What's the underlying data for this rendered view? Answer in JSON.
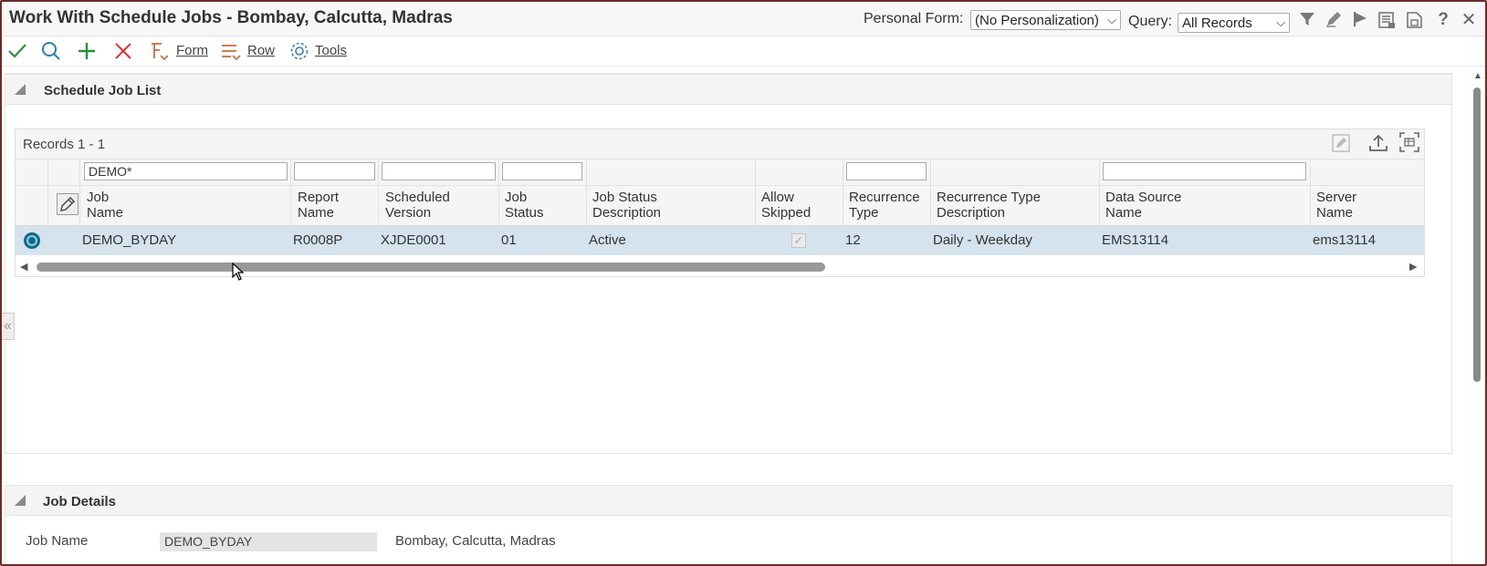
{
  "app": {
    "title": "Work With Schedule Jobs - Bombay, Calcutta, Madras"
  },
  "header": {
    "personal_form_label": "Personal Form:",
    "personal_form_value": "(No Personalization)",
    "query_label": "Query:",
    "query_value": "All Records",
    "icons": [
      "filter-icon",
      "pencil-icon",
      "flag-icon",
      "list-report-icon",
      "save-form-icon",
      "help-icon",
      "close-icon"
    ]
  },
  "toolbar": {
    "select_icon": "checkmark-icon",
    "find_icon": "search-icon",
    "add_icon": "plus-icon",
    "delete_icon": "x-icon",
    "form_label": "Form",
    "row_label": "Row",
    "tools_label": "Tools"
  },
  "schedule_list": {
    "title": "Schedule Job List",
    "records": "Records 1 - 1",
    "filters": {
      "job_name": "DEMO*",
      "report_name": "",
      "scheduled_version": "",
      "job_status": "",
      "recurrence_type": "",
      "data_source_name": ""
    },
    "columns": {
      "job_name": [
        "Job",
        "Name"
      ],
      "report_name": [
        "Report",
        "Name"
      ],
      "scheduled_version": [
        "Scheduled",
        "Version"
      ],
      "job_status": [
        "Job",
        "Status"
      ],
      "job_status_desc": [
        "Job Status",
        "Description"
      ],
      "allow_skipped": [
        "Allow",
        "Skipped"
      ],
      "recurrence_type": [
        "Recurrence",
        "Type"
      ],
      "recurrence_type_desc": [
        "Recurrence Type",
        "Description"
      ],
      "data_source_name": [
        "Data Source",
        "Name"
      ],
      "server_name": [
        "Server",
        "Name"
      ]
    },
    "rows": [
      {
        "job_name": "DEMO_BYDAY",
        "report_name": "R0008P",
        "scheduled_version": "XJDE0001",
        "job_status": "01",
        "job_status_desc": "Active",
        "allow_skipped": "checked",
        "recurrence_type": "12",
        "recurrence_type_desc": "Daily - Weekday",
        "data_source_name": "EMS13114",
        "server_name": "ems13114"
      }
    ]
  },
  "job_details": {
    "title": "Job Details",
    "job_name_label": "Job Name",
    "job_name_value": "DEMO_BYDAY",
    "job_name_desc": "Bombay, Calcutta, Madras"
  },
  "colors": {
    "selected_row": "#d5e3ee",
    "radio": "#0d6a8a",
    "check_green": "#3a8a3a",
    "add_green": "#2e8b3a",
    "delete_red": "#d33",
    "search_blue": "#2a7fb8",
    "frame": "#6b2a2a"
  }
}
